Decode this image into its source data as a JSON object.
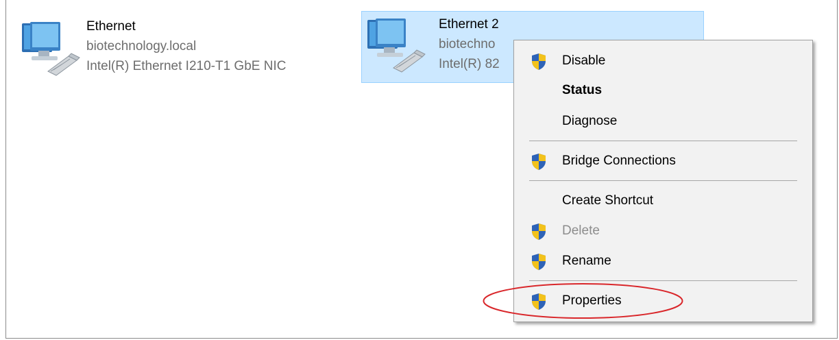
{
  "adapters": [
    {
      "name": "Ethernet",
      "network": "biotechnology.local",
      "device": "Intel(R) Ethernet I210-T1 GbE NIC",
      "icon": "network-adapter-icon"
    },
    {
      "name": "Ethernet 2",
      "network": "biotechno",
      "device": "Intel(R) 82",
      "icon": "network-adapter-icon"
    }
  ],
  "context_menu": {
    "items": [
      {
        "label": "Disable",
        "shield": true
      },
      {
        "label": "Status",
        "bold": true
      },
      {
        "label": "Diagnose"
      },
      {
        "label": "Bridge Connections",
        "shield": true
      },
      {
        "label": "Create Shortcut"
      },
      {
        "label": "Delete",
        "shield": true,
        "disabled": true
      },
      {
        "label": "Rename",
        "shield": true
      },
      {
        "label": "Properties",
        "shield": true,
        "highlighted": true
      }
    ]
  },
  "annotation": {
    "color": "#d9262a",
    "shape": "ellipse",
    "target": "Properties"
  },
  "colors": {
    "selection": "#cce8ff",
    "selection_border": "#99d1ff",
    "menu_bg": "#f2f2f2",
    "shield_blue": "#2e63b7",
    "shield_yellow": "#f3c21b"
  }
}
